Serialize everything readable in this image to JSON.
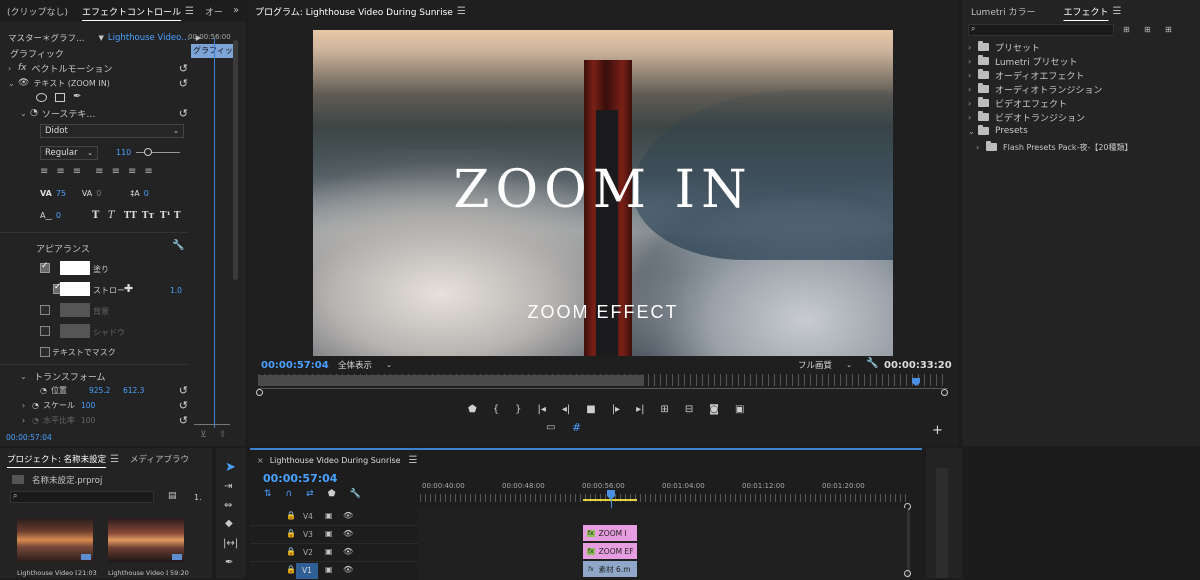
{
  "effect_panel": {
    "tabs": [
      "(クリップなし)",
      "エフェクトコントロール",
      "オー"
    ],
    "master_label": "マスター＊グラフ…",
    "clip_label": "Lighthouse Video…",
    "timecode_head": "00:00:56:00",
    "clip_chip": "グラフィッ",
    "graphic_label": "グラフィック",
    "vector_motion": "ベクトルモーション",
    "text_layer": "テキスト (ZOOM IN)",
    "source_text": "ソーステキ…",
    "font": "Didot",
    "style": "Regular",
    "font_size": "110",
    "tracking": "75",
    "kerning": "0",
    "leading": "0",
    "baseline": "0",
    "tsume": "0",
    "type_buttons": [
      "T",
      "T",
      "TT",
      "Tт",
      "T¹",
      "T"
    ],
    "appearance": "アピアランス",
    "fill": "塗り",
    "stroke": "ストロー",
    "stroke_width": "1.0",
    "background": "背景",
    "shadow": "シャドウ",
    "mask_text": "テキストでマスク",
    "transform": "トランスフォーム",
    "position": "位置",
    "pos_x": "925.2",
    "pos_y": "612.3",
    "scale": "スケール",
    "scale_val": "100",
    "hscale": "水平比率",
    "hscale_val": "100",
    "current_tc": "00:00:57:04"
  },
  "program": {
    "title": "プログラム: Lighthouse Video During Sunrise",
    "overlay_title": "ZOOM IN",
    "overlay_subtitle": "ZOOM EFFECT",
    "timecode": "00:00:57:04",
    "fit": "全体表示",
    "quality": "フル画質",
    "duration": "00:00:33:20"
  },
  "effects_panel": {
    "tabs": [
      "Lumetri カラー",
      "エフェクト"
    ],
    "items": [
      {
        "label": "プリセット",
        "depth": 0,
        "open": false
      },
      {
        "label": "Lumetri プリセット",
        "depth": 0,
        "open": false
      },
      {
        "label": "オーディオエフェクト",
        "depth": 0,
        "open": false
      },
      {
        "label": "オーディオトランジション",
        "depth": 0,
        "open": false
      },
      {
        "label": "ビデオエフェクト",
        "depth": 0,
        "open": false
      },
      {
        "label": "ビデオトランジション",
        "depth": 0,
        "open": false
      },
      {
        "label": "Presets",
        "depth": 0,
        "open": true
      },
      {
        "label": "Flash Presets Pack-夜-【20種類】",
        "depth": 1,
        "open": false
      }
    ]
  },
  "project": {
    "tabs": [
      "プロジェクト: 名称未設定",
      "メディアブラウ"
    ],
    "file": "名称未設定.prproj",
    "count": "1.",
    "clips": [
      {
        "name": "Lighthouse Video D…",
        "dur": "21:03"
      },
      {
        "name": "Lighthouse Video D…",
        "dur": "59:20"
      }
    ]
  },
  "timeline": {
    "title": "Lighthouse Video During Sunrise",
    "timecode": "00:00:57:04",
    "ruler": [
      "00:00:40:00",
      "00:00:48:00",
      "00:00:56:00",
      "00:01:04:00",
      "00:01:12:00",
      "00:01:20:00"
    ],
    "tracks": [
      "V4",
      "V3",
      "V2",
      "V1"
    ],
    "clips": [
      {
        "label": "ZOOM I",
        "track": "V3"
      },
      {
        "label": "ZOOM EF",
        "track": "V2"
      },
      {
        "label": "素材 6.m",
        "track": "V1"
      }
    ]
  }
}
